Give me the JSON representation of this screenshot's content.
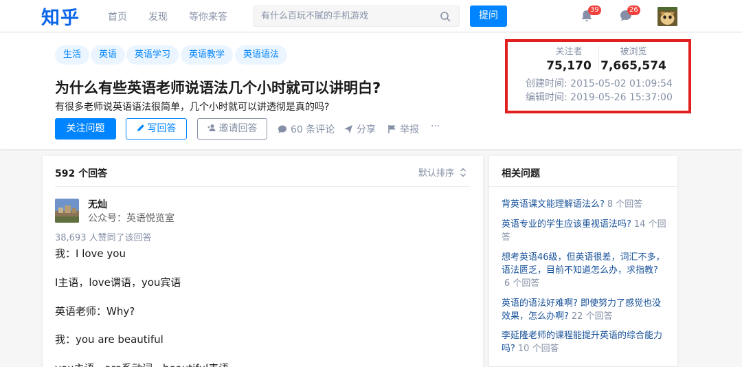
{
  "topbar": {
    "logo": "知乎",
    "nav": [
      "首页",
      "发现",
      "等你来答"
    ],
    "search_placeholder": "有什么百玩不腻的手机游戏",
    "ask_label": "提问",
    "notifications_count": "39",
    "messages_count": "26"
  },
  "question": {
    "tags": [
      "生活",
      "英语",
      "英语学习",
      "英语教学",
      "英语语法"
    ],
    "title": "为什么有些英语老师说语法几个小时就可以讲明白?",
    "detail": "有很多老师说英语语法很简单，几个小时就可以讲透彻是真的吗?",
    "follow_label": "关注问题",
    "write_label": "写回答",
    "invite_label": "邀请回答",
    "comments_label": "60 条评论",
    "share_label": "分享",
    "report_label": "举报",
    "more_label": "···"
  },
  "stats": {
    "followers_label": "关注者",
    "followers_value": "75,170",
    "views_label": "被浏览",
    "views_value": "7,665,574",
    "created": "创建时间:  2015-05-02 01:09:54",
    "edited": "编辑时间:  2019-05-26 15:37:00",
    "highlight_color": "#e21f1f"
  },
  "answers": {
    "count_label": "592 个回答",
    "sort_label": "默认排序",
    "author_name": "无灿",
    "author_bio": "公众号：英语悦览室",
    "votes": "38,693 人赞同了该回答",
    "lines": [
      "我：I love you",
      "I主语，love谓语，you宾语",
      "英语老师：Why?",
      "我：you are beautiful",
      "you主语，are系动词，beautiful表语"
    ]
  },
  "related": {
    "title": "相关问题",
    "items": [
      {
        "text": "背英语课文能理解语法么?",
        "count": "8 个回答"
      },
      {
        "text": "英语专业的学生应该重视语法吗?",
        "count": "14 个回答"
      },
      {
        "text": "想考英语46级，但英语很差，词汇不多，语法匮乏，目前不知道怎么办，求指教?",
        "count": "6 个回答"
      },
      {
        "text": "英语的语法好难啊? 即使努力了感觉也没效果，怎么办啊?",
        "count": "22 个回答"
      },
      {
        "text": "李延隆老师的课程能提升英语的综合能力吗?",
        "count": "10 个回答"
      }
    ]
  },
  "colors": {
    "brand": "#0084ff",
    "link": "#175199",
    "muted": "#8590a6"
  }
}
